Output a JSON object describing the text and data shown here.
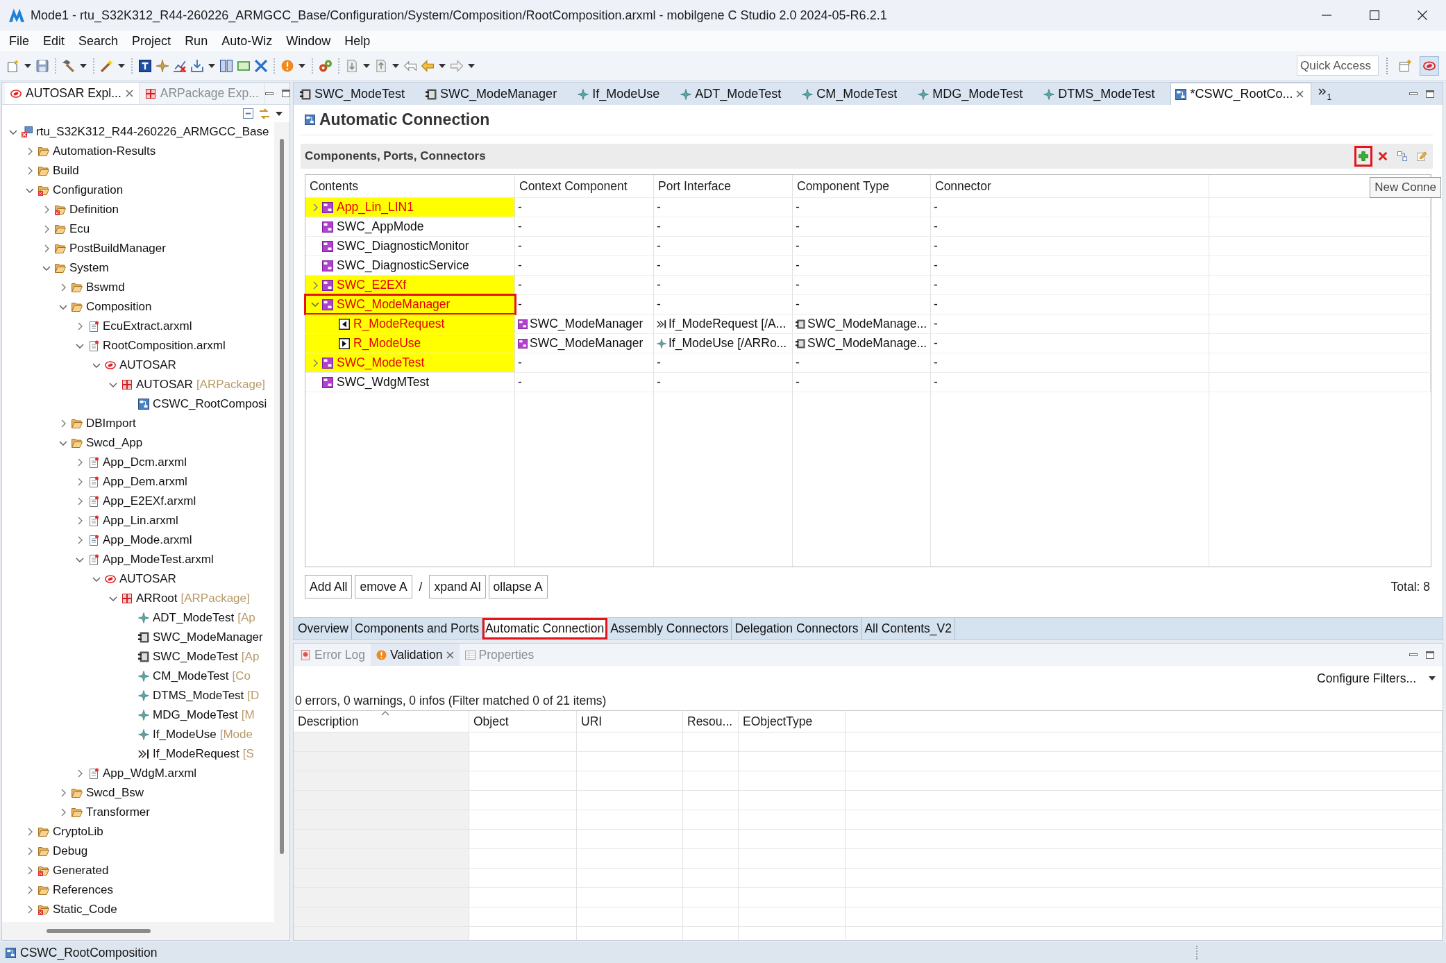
{
  "window": {
    "title": "Mode1 - rtu_S32K312_R44-260226_ARMGCC_Base/Configuration/System/Composition/RootComposition.arxml - mobilgene C Studio 2.0 2024-05-R6.2.1"
  },
  "menu": [
    "File",
    "Edit",
    "Search",
    "Project",
    "Run",
    "Auto-Wiz",
    "Window",
    "Help"
  ],
  "quick_access": {
    "placeholder": "Quick Access"
  },
  "explorer": {
    "tabs": [
      {
        "label": "AUTOSAR Expl...",
        "kind": "autosar",
        "selected": true
      },
      {
        "label": "ARPackage Exp...",
        "kind": "package",
        "selected": false
      }
    ],
    "tree": [
      {
        "label": "rtu_S32K312_R44-260226_ARMGCC_Base",
        "kind": "project",
        "expanded": true,
        "children": [
          {
            "label": "Automation-Results",
            "kind": "folder",
            "expanded": false
          },
          {
            "label": "Build",
            "kind": "folder",
            "expanded": false
          },
          {
            "label": "Configuration",
            "kind": "error-folder",
            "expanded": true,
            "children": [
              {
                "label": "Definition",
                "kind": "error-folder",
                "expanded": false
              },
              {
                "label": "Ecu",
                "kind": "folder",
                "expanded": false
              },
              {
                "label": "PostBuildManager",
                "kind": "folder",
                "expanded": false
              },
              {
                "label": "System",
                "kind": "folder",
                "expanded": true,
                "children": [
                  {
                    "label": "Bswmd",
                    "kind": "folder",
                    "expanded": false
                  },
                  {
                    "label": "Composition",
                    "kind": "folder",
                    "expanded": true,
                    "children": [
                      {
                        "label": "EcuExtract.arxml",
                        "kind": "file",
                        "expanded": false
                      },
                      {
                        "label": "RootComposition.arxml",
                        "kind": "file",
                        "expanded": true,
                        "children": [
                          {
                            "label": "AUTOSAR",
                            "kind": "autosar",
                            "expanded": true,
                            "children": [
                              {
                                "label": "AUTOSAR",
                                "suffix": "[ARPackage]",
                                "kind": "package",
                                "expanded": true,
                                "children": [
                                  {
                                    "label": "CSWC_RootComposi",
                                    "kind": "composition"
                                  }
                                ]
                              }
                            ]
                          }
                        ]
                      }
                    ]
                  },
                  {
                    "label": "DBImport",
                    "kind": "folder",
                    "expanded": false
                  },
                  {
                    "label": "Swcd_App",
                    "kind": "folder",
                    "expanded": true,
                    "children": [
                      {
                        "label": "App_Dcm.arxml",
                        "kind": "file",
                        "expanded": false
                      },
                      {
                        "label": "App_Dem.arxml",
                        "kind": "file",
                        "expanded": false
                      },
                      {
                        "label": "App_E2EXf.arxml",
                        "kind": "file",
                        "expanded": false
                      },
                      {
                        "label": "App_Lin.arxml",
                        "kind": "file",
                        "expanded": false
                      },
                      {
                        "label": "App_Mode.arxml",
                        "kind": "file",
                        "expanded": false
                      },
                      {
                        "label": "App_ModeTest.arxml",
                        "kind": "file",
                        "expanded": true,
                        "children": [
                          {
                            "label": "AUTOSAR",
                            "kind": "autosar",
                            "expanded": true,
                            "children": [
                              {
                                "label": "ARRoot",
                                "suffix": "[ARPackage]",
                                "kind": "package",
                                "expanded": true,
                                "children": [
                                  {
                                    "label": "ADT_ModeTest",
                                    "suffix": "[Ap",
                                    "kind": "element"
                                  },
                                  {
                                    "label": "SWC_ModeManager",
                                    "kind": "component"
                                  },
                                  {
                                    "label": "SWC_ModeTest",
                                    "suffix": "[Ap",
                                    "kind": "component"
                                  },
                                  {
                                    "label": "CM_ModeTest",
                                    "suffix": "[Co",
                                    "kind": "element"
                                  },
                                  {
                                    "label": "DTMS_ModeTest",
                                    "suffix": "[D",
                                    "kind": "element"
                                  },
                                  {
                                    "label": "MDG_ModeTest",
                                    "suffix": "[M",
                                    "kind": "element"
                                  },
                                  {
                                    "label": "If_ModeUse",
                                    "suffix": "[Mode",
                                    "kind": "element"
                                  },
                                  {
                                    "label": "If_ModeRequest",
                                    "suffix": "[S",
                                    "kind": "interface"
                                  }
                                ]
                              }
                            ]
                          }
                        ]
                      },
                      {
                        "label": "App_WdgM.arxml",
                        "kind": "file",
                        "expanded": false
                      }
                    ]
                  },
                  {
                    "label": "Swcd_Bsw",
                    "kind": "folder",
                    "expanded": false
                  },
                  {
                    "label": "Transformer",
                    "kind": "folder",
                    "expanded": false
                  }
                ]
              }
            ]
          },
          {
            "label": "CryptoLib",
            "kind": "folder",
            "expanded": false
          },
          {
            "label": "Debug",
            "kind": "folder",
            "expanded": false
          },
          {
            "label": "Generated",
            "kind": "error-folder",
            "expanded": false
          },
          {
            "label": "References",
            "kind": "folder",
            "expanded": false
          },
          {
            "label": "Static_Code",
            "kind": "error-folder",
            "expanded": false
          }
        ]
      }
    ]
  },
  "editor": {
    "tabs": [
      {
        "label": "SWC_ModeTest",
        "kind": "component",
        "selected": false
      },
      {
        "label": "SWC_ModeManager",
        "kind": "component",
        "selected": false
      },
      {
        "label": "If_ModeUse",
        "kind": "element",
        "selected": false
      },
      {
        "label": "ADT_ModeTest",
        "kind": "element",
        "selected": false
      },
      {
        "label": "CM_ModeTest",
        "kind": "element",
        "selected": false
      },
      {
        "label": "MDG_ModeTest",
        "kind": "element",
        "selected": false
      },
      {
        "label": "DTMS_ModeTest",
        "kind": "element",
        "selected": false
      },
      {
        "label": "*CSWC_RootCo...",
        "kind": "composition",
        "selected": true
      }
    ],
    "hidden_tabs": "1"
  },
  "page": {
    "title": "Automatic Connection",
    "section": "Components, Ports, Connectors",
    "tools": [
      {
        "kind": "add",
        "annotated": true
      },
      {
        "kind": "delete",
        "annotated": false
      },
      {
        "kind": "layout",
        "annotated": false
      },
      {
        "kind": "edit",
        "annotated": false
      }
    ],
    "tooltip": "New Conne"
  },
  "table": {
    "columns": [
      "Contents",
      "Context Component",
      "Port Interface",
      "Component Type",
      "Connector"
    ],
    "rows": [
      {
        "name": "App_Lin_LIN1",
        "kind": "swc",
        "expanded": false,
        "highlighted": true,
        "annotated": false,
        "cells": [
          {
            "text": "-",
            "kind": "plain"
          },
          {
            "text": "-",
            "kind": "plain"
          },
          {
            "text": "-",
            "kind": "plain"
          },
          {
            "text": "-",
            "kind": "plain"
          }
        ]
      },
      {
        "name": "SWC_AppMode",
        "kind": "swc",
        "highlighted": false,
        "annotated": false,
        "cells": [
          {
            "text": "-",
            "kind": "plain"
          },
          {
            "text": "-",
            "kind": "plain"
          },
          {
            "text": "-",
            "kind": "plain"
          },
          {
            "text": "-",
            "kind": "plain"
          }
        ]
      },
      {
        "name": "SWC_DiagnosticMonitor",
        "kind": "swc",
        "highlighted": false,
        "annotated": false,
        "cells": [
          {
            "text": "-",
            "kind": "plain"
          },
          {
            "text": "-",
            "kind": "plain"
          },
          {
            "text": "-",
            "kind": "plain"
          },
          {
            "text": "-",
            "kind": "plain"
          }
        ]
      },
      {
        "name": "SWC_DiagnosticService",
        "kind": "swc",
        "highlighted": false,
        "annotated": false,
        "cells": [
          {
            "text": "-",
            "kind": "plain"
          },
          {
            "text": "-",
            "kind": "plain"
          },
          {
            "text": "-",
            "kind": "plain"
          },
          {
            "text": "-",
            "kind": "plain"
          }
        ]
      },
      {
        "name": "SWC_E2EXf",
        "kind": "swc",
        "expanded": false,
        "highlighted": true,
        "annotated": false,
        "cells": [
          {
            "text": "-",
            "kind": "plain"
          },
          {
            "text": "-",
            "kind": "plain"
          },
          {
            "text": "-",
            "kind": "plain"
          },
          {
            "text": "-",
            "kind": "plain"
          }
        ]
      },
      {
        "name": "SWC_ModeManager",
        "kind": "swc",
        "expanded": true,
        "highlighted": true,
        "annotated": true,
        "cells": [
          {
            "text": "-",
            "kind": "plain"
          },
          {
            "text": "-",
            "kind": "plain"
          },
          {
            "text": "-",
            "kind": "plain"
          },
          {
            "text": "-",
            "kind": "plain"
          }
        ],
        "children": [
          {
            "name": "R_ModeRequest",
            "kind": "left-port",
            "highlighted": true,
            "annotated": false,
            "cells": [
              {
                "text": "SWC_ModeManager",
                "kind": "swc"
              },
              {
                "text": "If_ModeRequest [/A...",
                "kind": "interface"
              },
              {
                "text": "SWC_ModeManage...",
                "kind": "component"
              },
              {
                "text": "-",
                "kind": "plain"
              }
            ]
          },
          {
            "name": "R_ModeUse",
            "kind": "right-port",
            "highlighted": true,
            "annotated": false,
            "cells": [
              {
                "text": "SWC_ModeManager",
                "kind": "swc"
              },
              {
                "text": "If_ModeUse [/ARRo...",
                "kind": "element"
              },
              {
                "text": "SWC_ModeManage...",
                "kind": "component"
              },
              {
                "text": "-",
                "kind": "plain"
              }
            ]
          }
        ]
      },
      {
        "name": "SWC_ModeTest",
        "kind": "swc",
        "expanded": false,
        "highlighted": true,
        "annotated": false,
        "cells": [
          {
            "text": "-",
            "kind": "plain"
          },
          {
            "text": "-",
            "kind": "plain"
          },
          {
            "text": "-",
            "kind": "plain"
          },
          {
            "text": "-",
            "kind": "plain"
          }
        ]
      },
      {
        "name": "SWC_WdgMTest",
        "kind": "swc",
        "highlighted": false,
        "annotated": false,
        "cells": [
          {
            "text": "-",
            "kind": "plain"
          },
          {
            "text": "-",
            "kind": "plain"
          },
          {
            "text": "-",
            "kind": "plain"
          },
          {
            "text": "-",
            "kind": "plain"
          }
        ]
      }
    ]
  },
  "actions": [
    {
      "kind": "button",
      "label": "Add All"
    },
    {
      "kind": "button",
      "label": "emove A"
    },
    {
      "kind": "text",
      "label": "/"
    },
    {
      "kind": "button",
      "label": "xpand Al"
    },
    {
      "kind": "button",
      "label": "ollapse A"
    }
  ],
  "total": "Total: 8",
  "page_tabs": [
    {
      "label": "Overview",
      "selected": false,
      "annotated": false
    },
    {
      "label": "Components and Ports",
      "selected": false,
      "annotated": false
    },
    {
      "label": "Automatic Connection",
      "selected": true,
      "annotated": true
    },
    {
      "label": "Assembly Connectors",
      "selected": false,
      "annotated": false
    },
    {
      "label": "Delegation Connectors",
      "selected": false,
      "annotated": false
    },
    {
      "label": "All Contents_V2",
      "selected": false,
      "annotated": false
    }
  ],
  "validation": {
    "tabs": [
      {
        "label": "Error Log",
        "kind": "log",
        "selected": false
      },
      {
        "label": "Validation",
        "kind": "warning",
        "selected": true
      },
      {
        "label": "Properties",
        "kind": "properties",
        "selected": false
      }
    ],
    "configure": "Configure Filters...",
    "summary": "0 errors, 0 warnings, 0 infos (Filter matched 0 of 21 items)",
    "columns": [
      {
        "label": "Description",
        "sorted": true
      },
      {
        "label": "Object",
        "sorted": false
      },
      {
        "label": "URI",
        "sorted": false
      },
      {
        "label": "Resou...",
        "sorted": false
      },
      {
        "label": "EObjectType",
        "sorted": false
      }
    ]
  },
  "status_bar": {
    "text": "CSWC_RootComposition"
  }
}
